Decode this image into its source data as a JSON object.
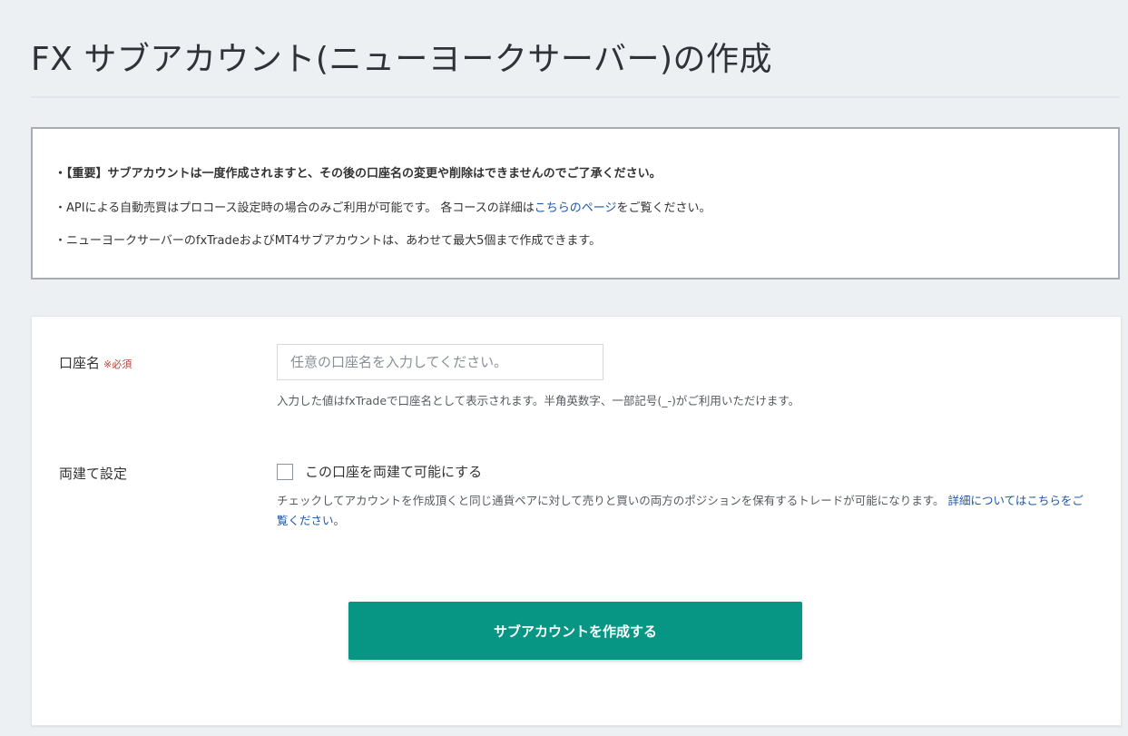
{
  "page": {
    "title": "FX サブアカウント(ニューヨークサーバー)の作成"
  },
  "notices": {
    "line1": "・【重要】サブアカウントは一度作成されますと、その後の口座名の変更や削除はできませんのでご了承ください。",
    "line2_before": "・APIによる自動売買はプロコース設定時の場合のみご利用が可能です。 各コースの詳細は",
    "line2_link": "こちらのページ",
    "line2_after": "をご覧ください。",
    "line3": "・ニューヨークサーバーのfxTradeおよびMT4サブアカウントは、あわせて最大5個まで作成できます。"
  },
  "form": {
    "account_name": {
      "label": "口座名",
      "required_mark": "※必須",
      "value": "",
      "placeholder": "任意の口座名を入力してください。",
      "help": "入力した値はfxTradeで口座名として表示されます。半角英数字、一部記号(_-)がご利用いただけます。"
    },
    "hedge": {
      "label": "両建て設定",
      "checkbox_label": "この口座を両建て可能にする",
      "checked": false,
      "help": "チェックしてアカウントを作成頂くと同じ通貨ペアに対して売りと買いの両方のポジションを保有するトレードが可能になります。 ",
      "help_link": "詳細についてはこちらをご覧ください",
      "help_after": "。"
    },
    "submit_label": "サブアカウントを作成する"
  },
  "colors": {
    "background": "#edf0f3",
    "accent": "#079683",
    "link": "#1d56a6",
    "required": "#c0392b",
    "notice_border": "#a6adb9"
  }
}
